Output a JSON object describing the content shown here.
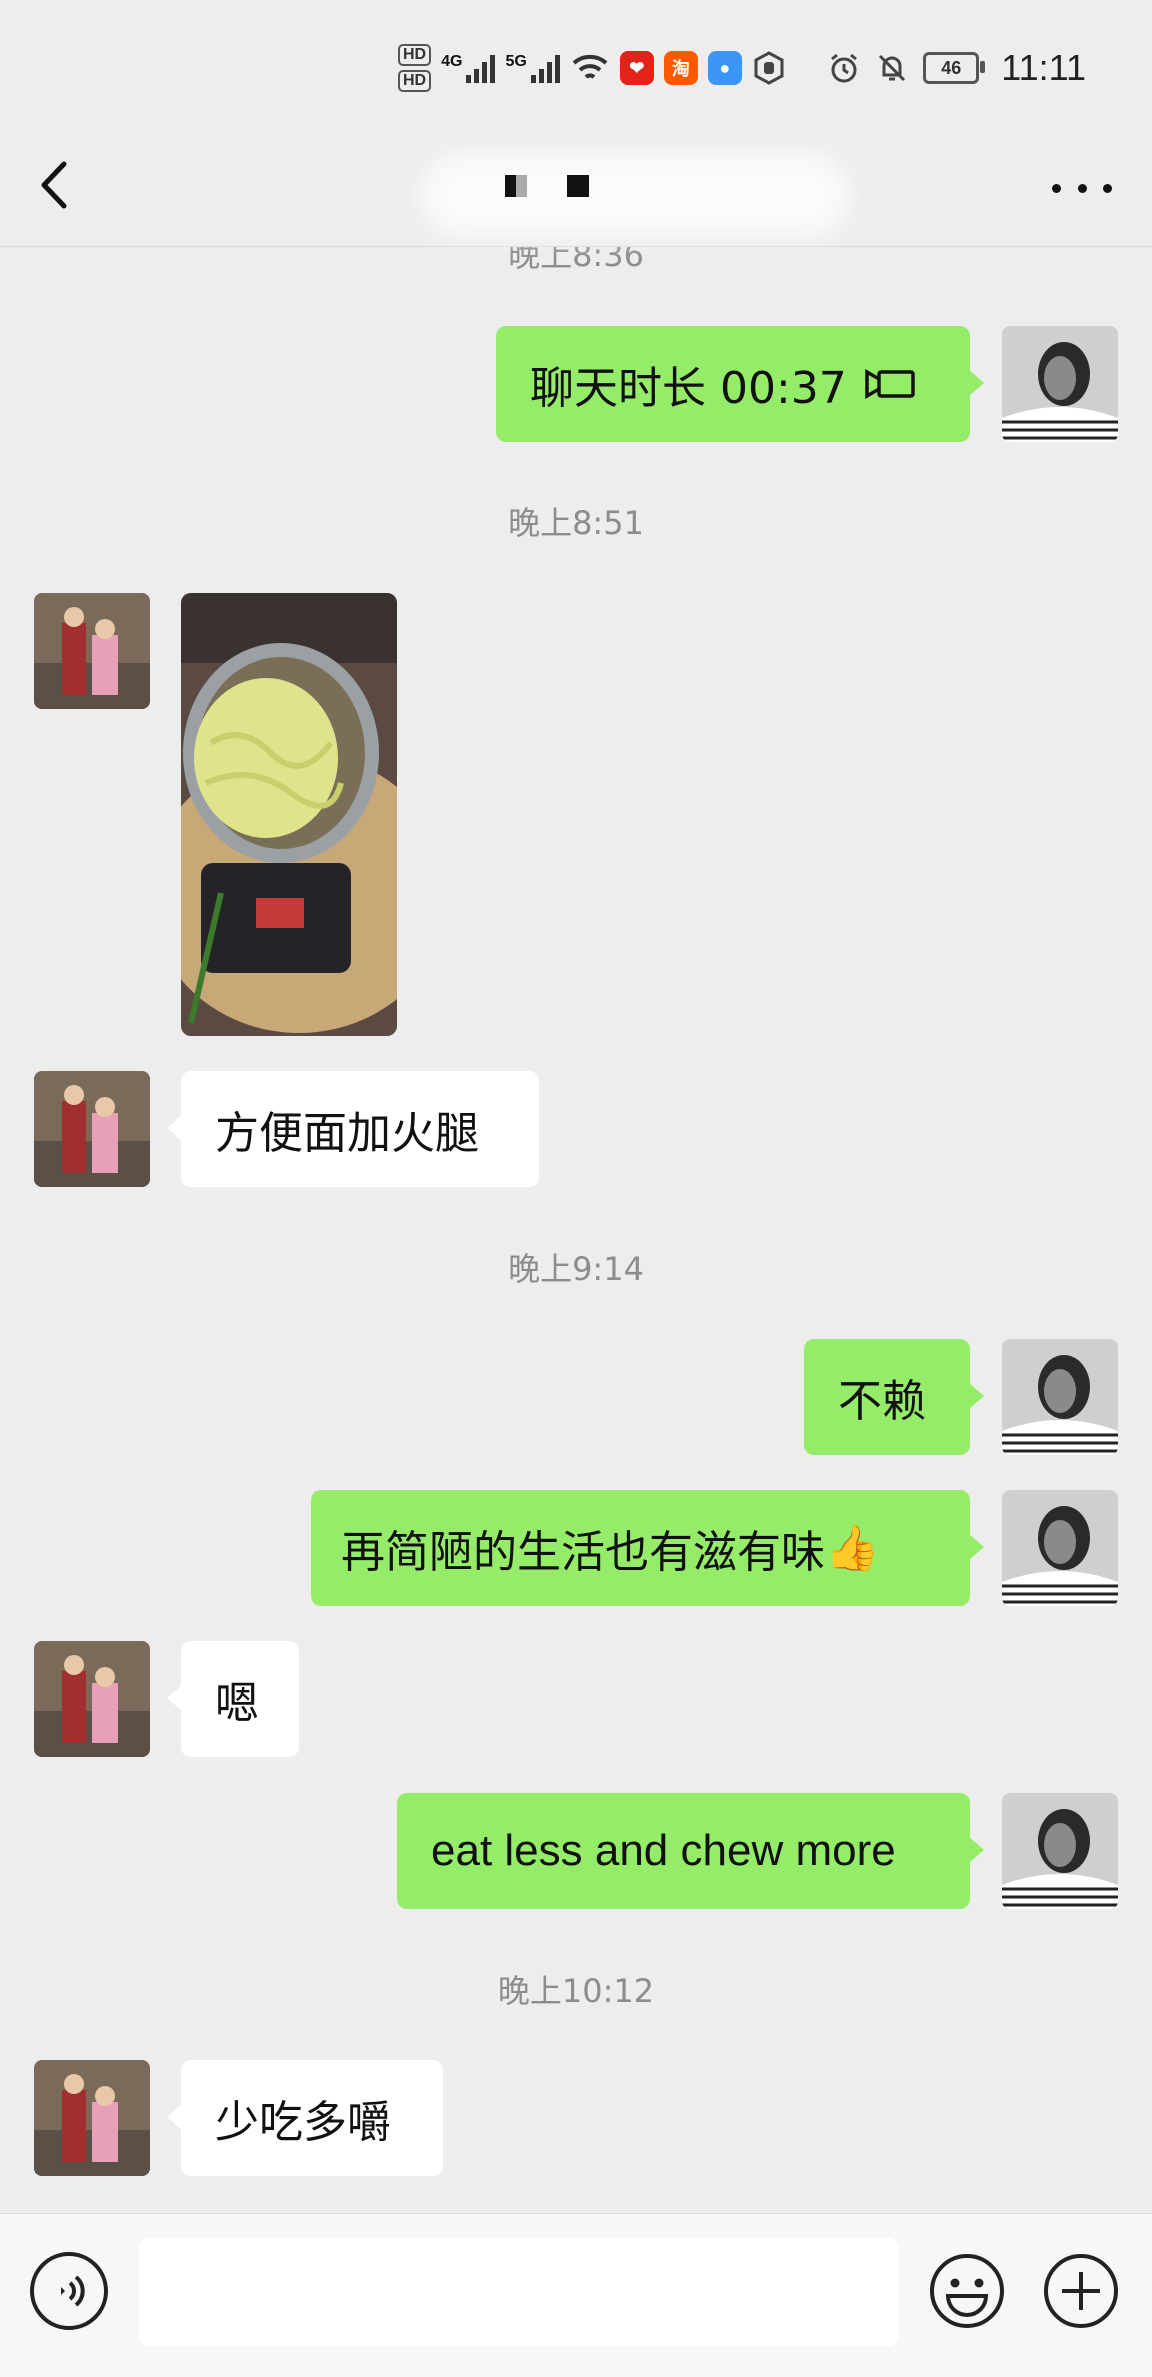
{
  "status_bar": {
    "hd_top": "HD",
    "hd_bottom": "HD",
    "net1": "4G",
    "net2": "5G",
    "app1_icon": "weibo-like-app-icon",
    "app2_label": "淘",
    "battery": "46",
    "time": "11:11",
    "icons": [
      "wifi-icon",
      "alarm-icon",
      "bell-muted-icon"
    ]
  },
  "nav": {
    "back_icon": "chevron-left-icon",
    "title_redacted": true,
    "more_icon": "more-icon"
  },
  "messages": [
    {
      "type": "timestamp",
      "text": "晚上8:36"
    },
    {
      "type": "call",
      "sender": "me",
      "text": "聊天时长 00:37",
      "icon": "video-call-icon"
    },
    {
      "type": "timestamp",
      "text": "晚上8:51"
    },
    {
      "type": "image",
      "sender": "them",
      "description": "noodle-pot-photo"
    },
    {
      "type": "text",
      "sender": "them",
      "text": "方便面加火腿"
    },
    {
      "type": "timestamp",
      "text": "晚上9:14"
    },
    {
      "type": "text",
      "sender": "me",
      "text": "不赖"
    },
    {
      "type": "text",
      "sender": "me",
      "text": "再简陋的生活也有滋有味",
      "emoji": "👍"
    },
    {
      "type": "text",
      "sender": "them",
      "text": "嗯"
    },
    {
      "type": "text",
      "sender": "me",
      "text": "eat less and chew more"
    },
    {
      "type": "timestamp",
      "text": "晚上10:12"
    },
    {
      "type": "text",
      "sender": "them",
      "text": "少吃多嚼"
    }
  ],
  "input_bar": {
    "voice_icon": "voice-icon",
    "placeholder": "",
    "emoji_icon": "emoji-icon",
    "plus_icon": "plus-icon"
  },
  "colors": {
    "background": "#ededed",
    "my_bubble": "#95ec69",
    "their_bubble": "#ffffff",
    "timestamp": "#8c8c8c"
  }
}
